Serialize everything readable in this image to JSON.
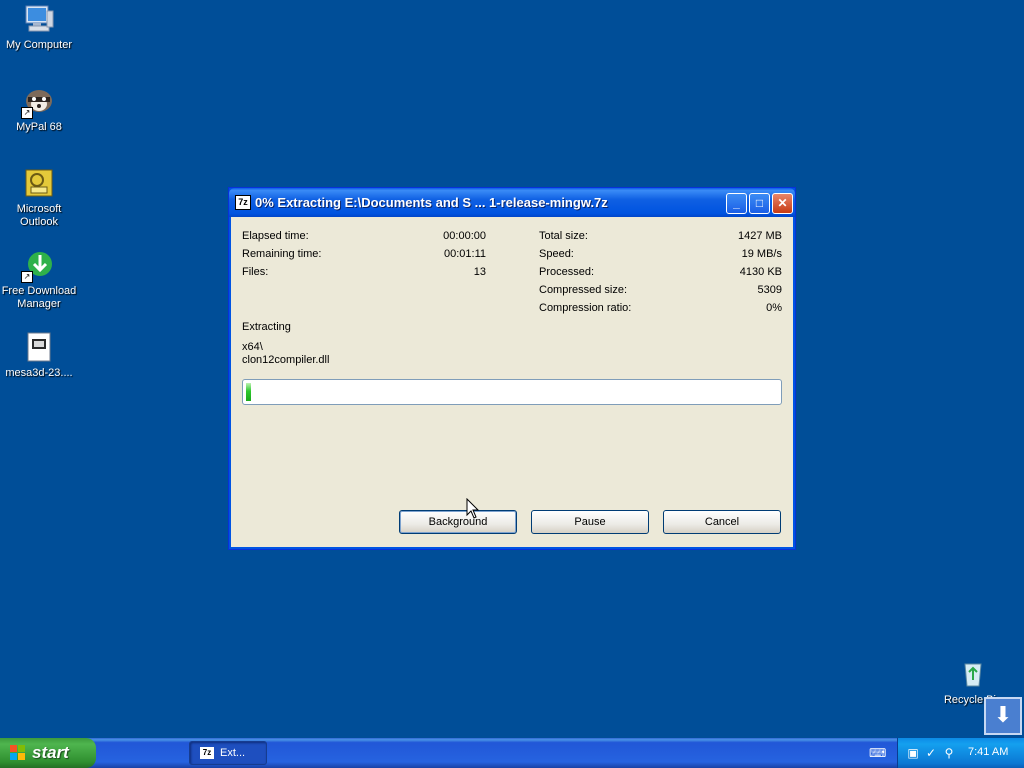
{
  "desktop": {
    "icons": [
      {
        "label": "My Computer",
        "icon": "my-computer-icon"
      },
      {
        "label": "MyPal 68",
        "icon": "mypal-raccoon-icon"
      },
      {
        "label": "Microsoft Outlook",
        "icon": "outlook-icon"
      },
      {
        "label": "Free Download Manager",
        "icon": "fdm-icon"
      },
      {
        "label": "mesa3d-23....",
        "icon": "archive-file-icon"
      },
      {
        "label": "Recycle Bin",
        "icon": "recycle-bin-icon"
      }
    ]
  },
  "dialog": {
    "title": "0% Extracting E:\\Documents and S ... 1-release-mingw.7z",
    "app_icon": "7z",
    "left_info": [
      {
        "label": "Elapsed time:",
        "value": "00:00:00"
      },
      {
        "label": "Remaining time:",
        "value": "00:01:11"
      },
      {
        "label": "Files:",
        "value": "13"
      }
    ],
    "right_info": [
      {
        "label": "Total size:",
        "value": "1427 MB"
      },
      {
        "label": "Speed:",
        "value": "19 MB/s"
      },
      {
        "label": "Processed:",
        "value": "4130 KB"
      },
      {
        "label": "Compressed size:",
        "value": "5309"
      },
      {
        "label": "Compression ratio:",
        "value": "0%"
      }
    ],
    "status": "Extracting",
    "current_path": "x64\\",
    "current_file": "clon12compiler.dll",
    "progress_fraction": 0.01,
    "buttons": {
      "background": "Background",
      "pause": "Pause",
      "cancel": "Cancel"
    }
  },
  "taskbar": {
    "start_label": "start",
    "items": [
      {
        "label": "Ext...",
        "icon": "7z"
      }
    ],
    "clock": "7:41 AM"
  },
  "colors": {
    "desktop": "#004e98",
    "titlebar": "#0053e0",
    "progress": "#2ec82e",
    "start_button": "#3c9a3c"
  }
}
